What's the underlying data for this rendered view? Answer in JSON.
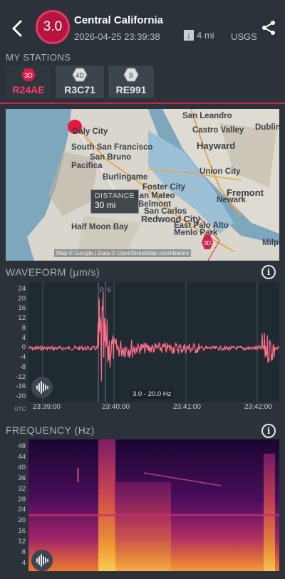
{
  "header": {
    "magnitude": "3.0",
    "title": "Central California",
    "datetime": "2026-04-25 23:39:38",
    "distance": "4 mi",
    "source": "USGS"
  },
  "stations": {
    "label": "MY STATIONS",
    "items": [
      {
        "badge": "3D",
        "name": "R24AE",
        "active": true
      },
      {
        "badge": "4D",
        "name": "R3C71",
        "active": false
      },
      {
        "badge": "B",
        "name": "RE991",
        "active": false
      }
    ]
  },
  "map": {
    "labels": [
      "San Leandro",
      "Castro Valley",
      "Dublin",
      "Daly City",
      "South San Francisco",
      "Hayward",
      "San Bruno",
      "Pacifica",
      "Union City",
      "Burlingame",
      "Foster City",
      "Fremont",
      "San Mateo",
      "Belmont",
      "Newark",
      "San Carlos",
      "Redwood City",
      "Half Moon Bay",
      "East Palo Alto",
      "Menlo Park",
      "Milpi"
    ],
    "distance_label": "DISTANCE",
    "distance_value": "30 mi",
    "attribution": "Map © Google | Data © OpenStreetMap contributors",
    "station_marker": "3D"
  },
  "waveform": {
    "title": "WAVEFORM (µm/s)",
    "y_ticks": [
      "24",
      "20",
      "16",
      "12",
      "8",
      "4",
      "0",
      "-4",
      "-8",
      "-12",
      "-16",
      "-20"
    ],
    "x_ticks": [
      "23:39:00",
      "23:40:00",
      "23:41:00",
      "23:42:00"
    ],
    "x_unit": "UTC",
    "filter": "3.0 - 20.0 Hz",
    "phase_p": "P",
    "phase_s": "S",
    "line_color": "#ff6f8a"
  },
  "frequency": {
    "title": "FREQUENCY (Hz)",
    "y_ticks": [
      "48",
      "44",
      "40",
      "36",
      "32",
      "28",
      "24",
      "20",
      "16",
      "12",
      "8",
      "4"
    ]
  },
  "icons": {
    "back": "chevron-left-icon",
    "share": "share-icon",
    "download": "arrow-down-icon",
    "info": "info-icon",
    "audio": "waveform-audio-icon"
  },
  "colors": {
    "accent": "#d4214b",
    "background": "#2b3239"
  }
}
